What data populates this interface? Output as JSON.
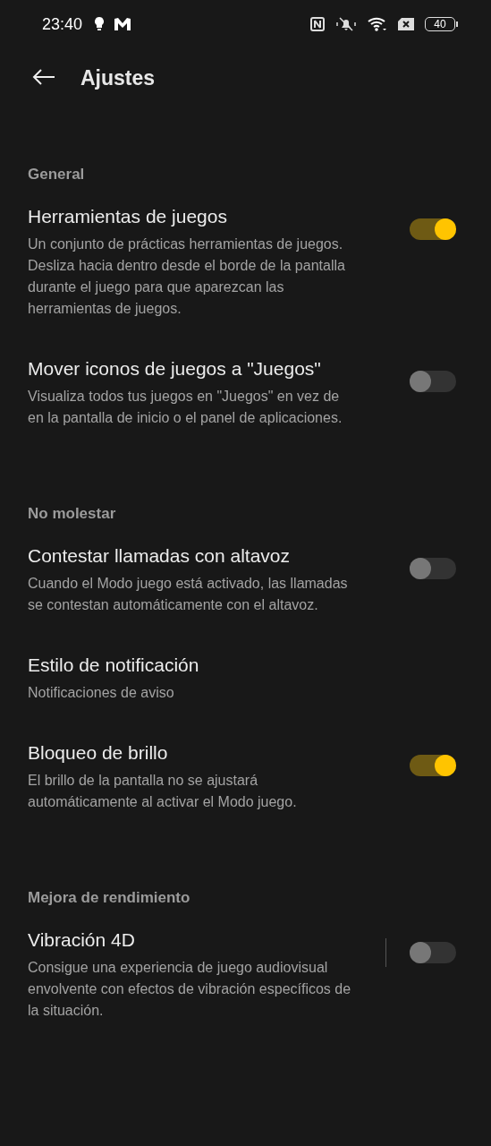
{
  "status_bar": {
    "time": "23:40",
    "battery": "40"
  },
  "header": {
    "title": "Ajustes"
  },
  "sections": [
    {
      "title": "General",
      "items": [
        {
          "kind": "toggle",
          "title": "Herramientas de juegos",
          "description": "Un conjunto de prácticas herramientas de juegos. Desliza hacia dentro desde el borde de la pantalla durante el juego para que aparezcan las herramientas de juegos.",
          "on": true
        },
        {
          "kind": "toggle",
          "title": "Mover iconos de juegos a \"Juegos\"",
          "description": "Visualiza todos tus juegos en \"Juegos\" en vez de en la pantalla de inicio o el panel de aplicaciones.",
          "on": false
        }
      ]
    },
    {
      "title": "No molestar",
      "items": [
        {
          "kind": "toggle",
          "title": "Contestar llamadas con altavoz",
          "description": "Cuando el Modo juego está activado, las llamadas se contestan automáticamente con el altavoz.",
          "on": false
        },
        {
          "kind": "link",
          "title": "Estilo de notificación",
          "description": "Notificaciones de aviso"
        },
        {
          "kind": "toggle",
          "title": "Bloqueo de brillo",
          "description": "El brillo de la pantalla no se ajustará automáticamente al activar el Modo juego.",
          "on": true
        }
      ]
    },
    {
      "title": "Mejora de rendimiento",
      "items": [
        {
          "kind": "toggle",
          "title": "Vibración 4D",
          "description": "Consigue una experiencia de juego audiovisual envolvente con efectos de vibración específicos de la situación.",
          "on": false,
          "divider": true
        }
      ]
    }
  ]
}
